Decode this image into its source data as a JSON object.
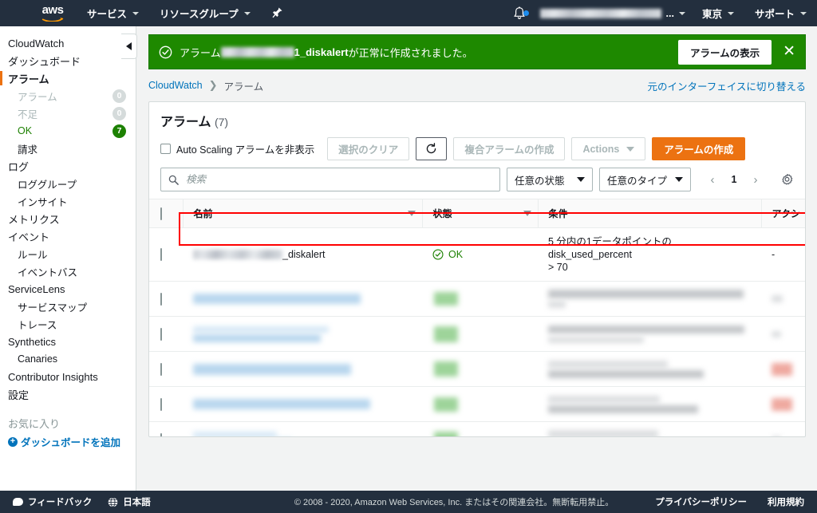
{
  "topnav": {
    "logo_text": "aws",
    "items": [
      {
        "label": "サービス",
        "icon": "chevron-down-icon"
      },
      {
        "label": "リソースグループ",
        "icon": "chevron-down-icon"
      }
    ],
    "pin_icon": "pin-icon",
    "bell_icon": "bell-icon",
    "account_label": "",
    "account_ellipsis": "...",
    "region": "東京",
    "support": "サポート"
  },
  "sidebar": {
    "items": [
      {
        "label": "CloudWatch",
        "level": 1,
        "state": "normal",
        "badge": null
      },
      {
        "label": "ダッシュボード",
        "level": 1,
        "state": "normal",
        "badge": null
      },
      {
        "label": "アラーム",
        "level": 1,
        "state": "active",
        "badge": null
      },
      {
        "label": "アラーム",
        "level": 2,
        "state": "dim",
        "badge": "0",
        "badge_style": "zero"
      },
      {
        "label": "不足",
        "level": 2,
        "state": "dim",
        "badge": "0",
        "badge_style": "zero"
      },
      {
        "label": "OK",
        "level": 2,
        "state": "ok",
        "badge": "7",
        "badge_style": "green"
      },
      {
        "label": "請求",
        "level": 2,
        "state": "normal",
        "badge": null
      },
      {
        "label": "ログ",
        "level": 1,
        "state": "normal",
        "badge": null
      },
      {
        "label": "ロググループ",
        "level": 2,
        "state": "normal",
        "badge": null
      },
      {
        "label": "インサイト",
        "level": 2,
        "state": "normal",
        "badge": null
      },
      {
        "label": "メトリクス",
        "level": 1,
        "state": "normal",
        "badge": null
      },
      {
        "label": "イベント",
        "level": 1,
        "state": "normal",
        "badge": null
      },
      {
        "label": "ルール",
        "level": 2,
        "state": "normal",
        "badge": null
      },
      {
        "label": "イベントバス",
        "level": 2,
        "state": "normal",
        "badge": null
      },
      {
        "label": "ServiceLens",
        "level": 1,
        "state": "normal",
        "badge": null
      },
      {
        "label": "サービスマップ",
        "level": 2,
        "state": "normal",
        "badge": null
      },
      {
        "label": "トレース",
        "level": 2,
        "state": "normal",
        "badge": null
      },
      {
        "label": "Synthetics",
        "level": 1,
        "state": "normal",
        "badge": null
      },
      {
        "label": "Canaries",
        "level": 2,
        "state": "normal",
        "badge": null
      },
      {
        "label": "Contributor Insights",
        "level": 1,
        "state": "normal",
        "badge": null
      },
      {
        "label": "設定",
        "level": 1,
        "state": "normal",
        "badge": null
      }
    ],
    "favorites_label": "お気に入り",
    "add_dashboard_label": "ダッシュボードを追加",
    "add_icon": "plus-circle-icon",
    "collapse_icon": "chevron-left-icon"
  },
  "banner": {
    "icon": "check-circle-icon",
    "text_prefix": "アラーム",
    "text_redacted_suffix": "1_diskalert",
    "text_tail": "が正常に作成されました。",
    "action_label": "アラームの表示",
    "close_icon": "close-icon",
    "color": "#1e8900"
  },
  "breadcrumb": {
    "root": "CloudWatch",
    "separator": "❯",
    "current": "アラーム",
    "switch_link": "元のインターフェイスに切り替える"
  },
  "panel": {
    "title": "アラーム",
    "count": "(7)",
    "toolbar": {
      "hide_autoscaling_label": "Auto Scaling アラームを非表示",
      "clear_selection_label": "選択のクリア",
      "refresh_icon": "refresh-icon",
      "create_composite_label": "複合アラームの作成",
      "actions_label": "Actions",
      "actions_icon": "chevron-down-icon",
      "create_alarm_label": "アラームの作成",
      "primary_color": "#ec7211"
    },
    "filters": {
      "search_placeholder": "検索",
      "search_value": "",
      "search_icon": "search-icon",
      "state_filter": "任意の状態",
      "type_filter": "任意のタイプ",
      "page_prev_icon": "chevron-left-icon",
      "page_number": "1",
      "page_next_icon": "chevron-right-icon",
      "settings_icon": "gear-icon"
    },
    "table": {
      "columns": [
        {
          "label": "",
          "sortable": false
        },
        {
          "label": "名前",
          "sortable": true
        },
        {
          "label": "状態",
          "sortable": true
        },
        {
          "label": "条件",
          "sortable": false
        },
        {
          "label": "アクシ",
          "sortable": false
        }
      ],
      "rows": [
        {
          "highlighted": true,
          "redacted": false,
          "name_redacted_prefix": true,
          "name_tail": "_diskalert",
          "state": "OK",
          "state_icon": "check-circle-icon",
          "condition_line1": "5 分内の1データポイントのdisk_used_percent",
          "condition_line2": "> 70",
          "action": "-"
        },
        {
          "highlighted": false,
          "redacted": true,
          "variant": 1
        },
        {
          "highlighted": false,
          "redacted": true,
          "variant": 2
        },
        {
          "highlighted": false,
          "redacted": true,
          "variant": 3
        },
        {
          "highlighted": false,
          "redacted": true,
          "variant": 4
        },
        {
          "highlighted": false,
          "redacted": true,
          "variant": 5
        },
        {
          "highlighted": false,
          "redacted": true,
          "variant": 6
        }
      ]
    }
  },
  "footer": {
    "feedback_label": "フィードバック",
    "feedback_icon": "speech-bubble-icon",
    "language_label": "日本語",
    "language_icon": "globe-icon",
    "copyright": "© 2008 - 2020, Amazon Web Services, Inc. またはその関連会社。無断転用禁止。",
    "privacy_label": "プライバシーポリシー",
    "terms_label": "利用規約"
  }
}
